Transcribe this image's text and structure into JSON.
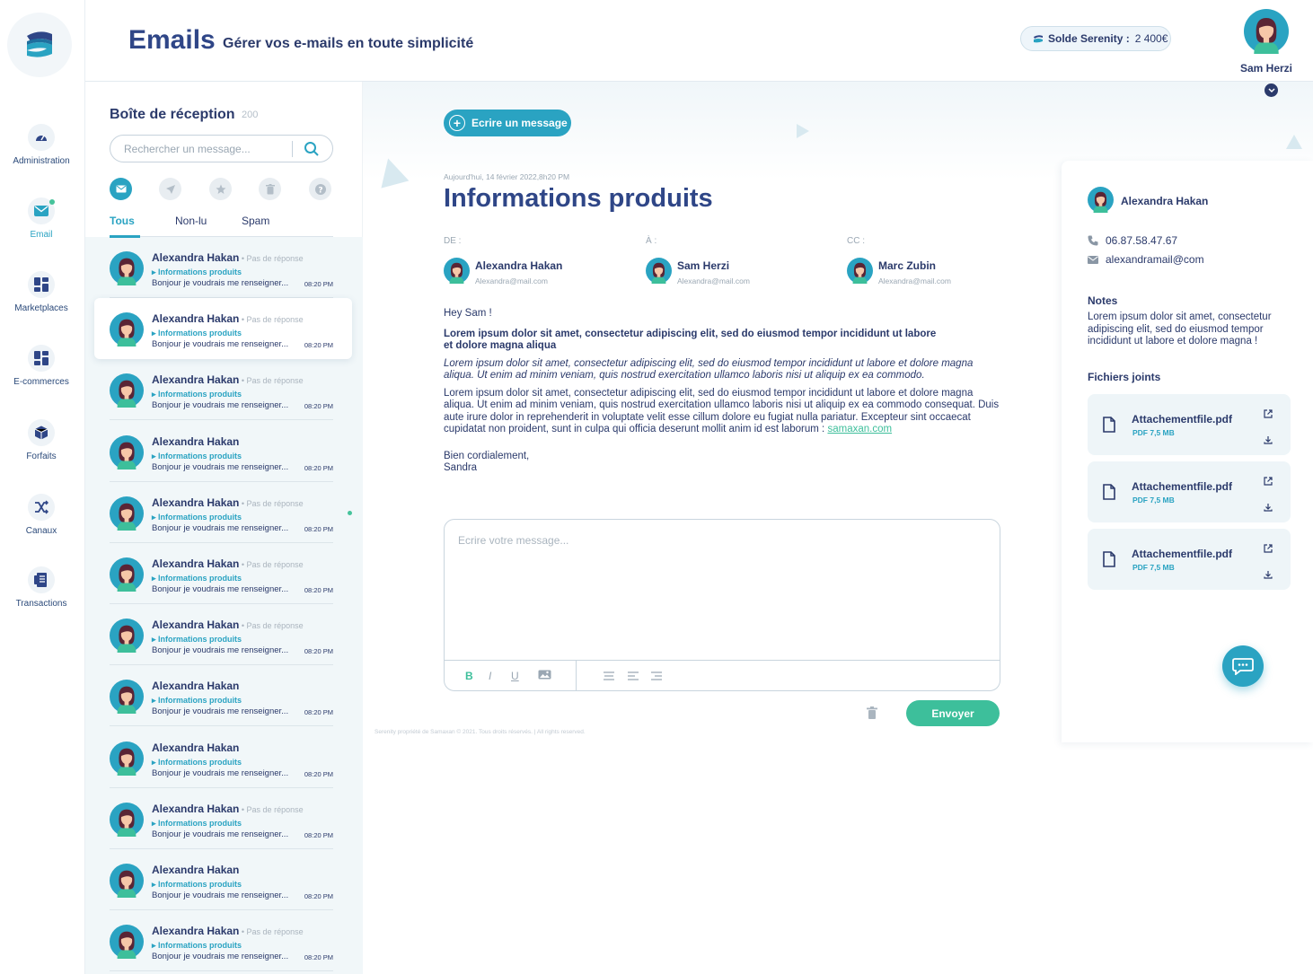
{
  "nav": {
    "items": [
      {
        "label": "Administration",
        "icon": "admin-icon"
      },
      {
        "label": "Email",
        "icon": "email-icon"
      },
      {
        "label": "Marketplaces",
        "icon": "marketplaces-icon"
      },
      {
        "label": "E-commerces",
        "icon": "ecommerces-icon"
      },
      {
        "label": "Forfaits",
        "icon": "forfaits-icon"
      },
      {
        "label": "Canaux",
        "icon": "canaux-icon"
      },
      {
        "label": "Transactions",
        "icon": "transactions-icon"
      }
    ]
  },
  "header": {
    "title": "Emails",
    "subtitle": "Gérer vos e-mails en toute simplicité",
    "solde_label": "Solde Serenity :",
    "solde_value": "2 400€",
    "user_name": "Sam Herzi"
  },
  "inbox": {
    "title": "Boîte de réception",
    "count": "200",
    "search_placeholder": "Rechercher un message...",
    "filters": [
      "all-mail-icon",
      "sent-icon",
      "star-icon",
      "trash-icon",
      "help-icon"
    ],
    "tabs": [
      "Tous",
      "Non-lu",
      "Spam"
    ],
    "messages": [
      {
        "name": "Alexandra Hakan",
        "status": "Pas de réponse",
        "subject": "Informations produits",
        "preview": "Bonjour je voudrais me renseigner...",
        "time": "08:20 PM"
      },
      {
        "name": "Alexandra Hakan",
        "status": "Pas de réponse",
        "subject": "Informations produits",
        "preview": "Bonjour je voudrais me renseigner...",
        "time": "08:20 PM"
      },
      {
        "name": "Alexandra Hakan",
        "status": "Pas de réponse",
        "subject": "Informations produits",
        "preview": "Bonjour je voudrais me renseigner...",
        "time": "08:20 PM"
      },
      {
        "name": "Alexandra Hakan",
        "status": "",
        "subject": "Informations produits",
        "preview": "Bonjour je voudrais me renseigner...",
        "time": "08:20 PM"
      },
      {
        "name": "Alexandra Hakan",
        "status": "Pas de réponse",
        "subject": "Informations produits",
        "preview": "Bonjour je voudrais me renseigner...",
        "time": "08:20 PM"
      },
      {
        "name": "Alexandra Hakan",
        "status": "Pas de réponse",
        "subject": "Informations produits",
        "preview": "Bonjour je voudrais me renseigner...",
        "time": "08:20 PM"
      },
      {
        "name": "Alexandra Hakan",
        "status": "Pas de réponse",
        "subject": "Informations produits",
        "preview": "Bonjour je voudrais me renseigner...",
        "time": "08:20 PM"
      },
      {
        "name": "Alexandra Hakan",
        "status": "",
        "subject": "Informations produits",
        "preview": "Bonjour je voudrais me renseigner...",
        "time": "08:20 PM"
      },
      {
        "name": "Alexandra Hakan",
        "status": "",
        "subject": "Informations produits",
        "preview": "Bonjour je voudrais me renseigner...",
        "time": "08:20 PM"
      },
      {
        "name": "Alexandra Hakan",
        "status": "Pas de réponse",
        "subject": "Informations produits",
        "preview": "Bonjour je voudrais me renseigner...",
        "time": "08:20 PM"
      },
      {
        "name": "Alexandra Hakan",
        "status": "",
        "subject": "Informations produits",
        "preview": "Bonjour je voudrais me renseigner...",
        "time": "08:20 PM"
      },
      {
        "name": "Alexandra Hakan",
        "status": "Pas de réponse",
        "subject": "Informations produits",
        "preview": "Bonjour je voudrais me renseigner...",
        "time": "08:20 PM"
      }
    ]
  },
  "message": {
    "compose_label": "Ecrire un message",
    "date": "Aujourd'hui, 14 février 2022,8h20 PM",
    "title": "Informations produits",
    "from_label": "DE :",
    "to_label": "À :",
    "cc_label": "CC :",
    "from": {
      "name": "Alexandra Hakan",
      "email": "Alexandra@mail.com"
    },
    "to": {
      "name": "Sam Herzi",
      "email": "Alexandra@mail.com"
    },
    "cc": {
      "name": "Marc Zubin",
      "email": "Alexandra@mail.com"
    },
    "greeting": "Hey Sam !",
    "bold_paragraph": "Lorem ipsum dolor sit amet, consectetur adipiscing elit, sed do eiusmod tempor incididunt ut labore et dolore magna aliqua",
    "italic_paragraph": "Lorem ipsum dolor sit amet, consectetur adipiscing elit, sed do eiusmod tempor incididunt ut labore et dolore magna aliqua. Ut enim ad minim veniam, quis nostrud exercitation ullamco laboris nisi ut aliquip ex ea commodo.",
    "paragraph": "Lorem ipsum dolor sit amet, consectetur adipiscing elit, sed do eiusmod tempor incididunt ut labore et dolore magna aliqua. Ut enim ad minim veniam, quis nostrud exercitation ullamco laboris nisi ut aliquip ex ea commodo consequat. Duis aute irure dolor in reprehenderit in voluptate velit esse cillum dolore eu fugiat nulla pariatur. Excepteur sint occaecat cupidatat non proident, sunt in culpa qui officia deserunt mollit anim id est laborum :",
    "link": "samaxan.com",
    "closing": "Bien cordialement,",
    "signature": "Sandra",
    "reply_placeholder": "Ecrire votre message...",
    "toolbar": {
      "bold": "B",
      "italic": "I",
      "underline": "U"
    },
    "send_label": "Envoyer",
    "footer": "Serenity propriété de Samaxan © 2021. Tous droits réservés. | All rights reserved."
  },
  "contact": {
    "name": "Alexandra Hakan",
    "phone": "06.87.58.47.67",
    "email": "alexandramail@com",
    "notes_title": "Notes",
    "notes": "Lorem ipsum dolor sit amet, consectetur adipiscing elit, sed do eiusmod tempor incididunt ut labore et dolore magna !",
    "files_title": "Fichiers joints",
    "files": [
      {
        "name": "Attachementfile.pdf",
        "size": "PDF 7,5 MB"
      },
      {
        "name": "Attachementfile.pdf",
        "size": "PDF 7,5 MB"
      },
      {
        "name": "Attachementfile.pdf",
        "size": "PDF 7,5 MB"
      }
    ]
  },
  "colors": {
    "accent": "#2aa3c2",
    "green": "#3dbf9b",
    "navy": "#2f4687"
  }
}
